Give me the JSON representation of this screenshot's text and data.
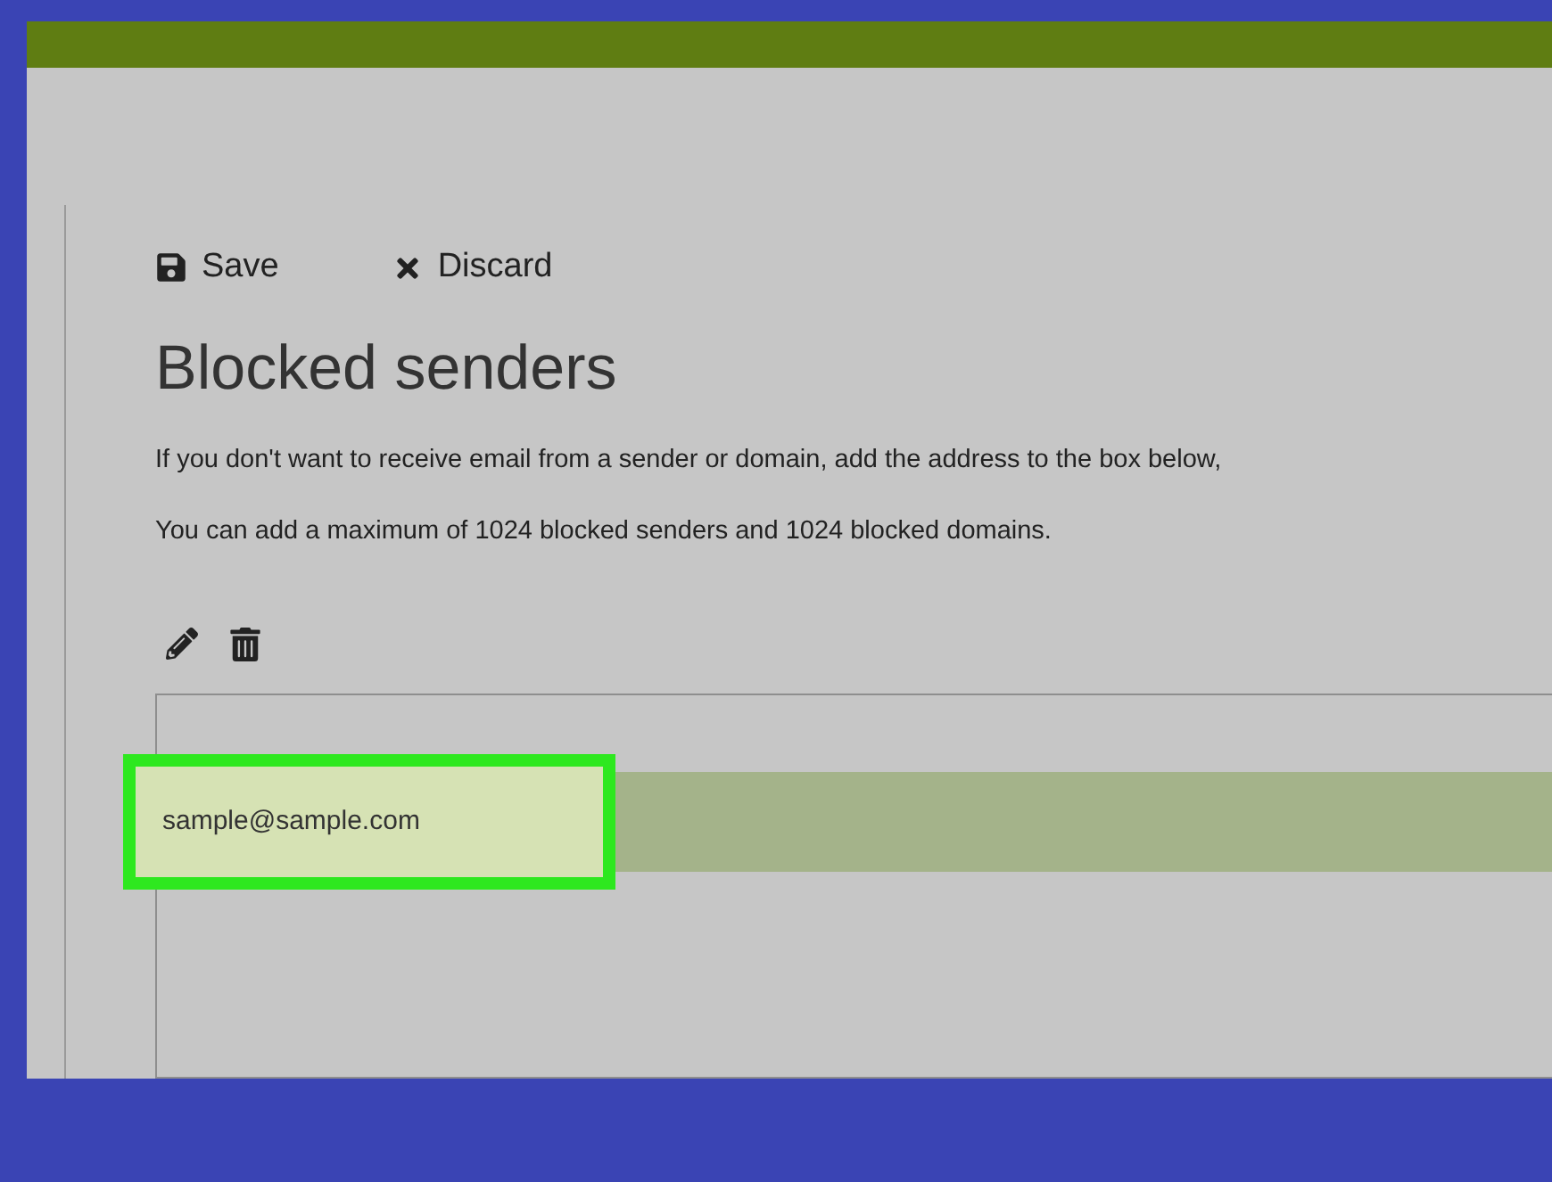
{
  "toolbar": [
    {
      "kind": "save",
      "label": "Save"
    },
    {
      "kind": "discard",
      "label": "Discard"
    }
  ],
  "title": "Blocked senders",
  "paragraphs": [
    "If you don't want to receive email from a sender or domain, add the address to the box below,",
    "You can add a maximum of 1024 blocked senders and 1024 blocked domains."
  ],
  "list_actions": [
    {
      "kind": "edit"
    },
    {
      "kind": "delete"
    }
  ],
  "entries": [
    {
      "address": "sample@sample.com",
      "selected": true,
      "highlighted": true
    }
  ]
}
